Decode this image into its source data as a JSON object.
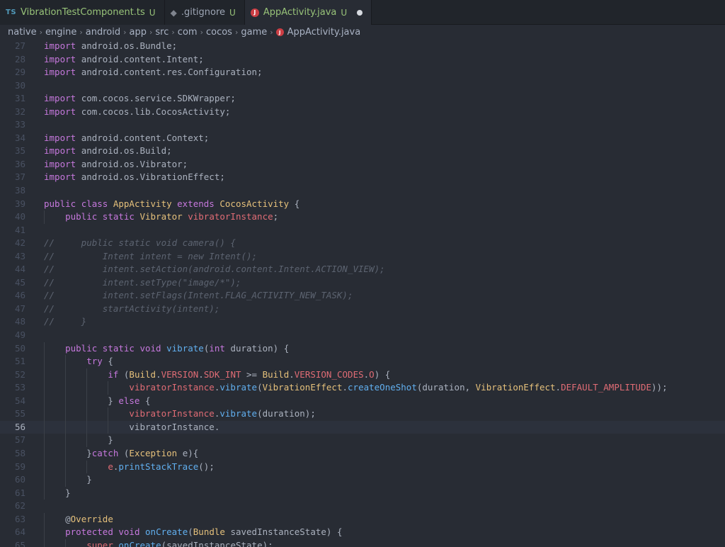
{
  "tabs": [
    {
      "icon": "TS",
      "icon_kind": "ts",
      "label": "VibrationTestComponent.ts",
      "status": "U",
      "active": false
    },
    {
      "icon": "◆",
      "icon_kind": "git",
      "label": ".gitignore",
      "status": "U",
      "active": false
    },
    {
      "icon": "J",
      "icon_kind": "java",
      "label": "AppActivity.java",
      "status": "U",
      "active": true,
      "unsaved": true
    }
  ],
  "breadcrumb": [
    "native",
    "engine",
    "android",
    "app",
    "src",
    "com",
    "cocos",
    "game",
    "AppActivity.java"
  ],
  "current_line": 56,
  "code_lines": [
    {
      "n": "27",
      "t": [
        [
          "keyword",
          "import "
        ],
        [
          "plain",
          "android.os.Bundle;"
        ]
      ]
    },
    {
      "n": "28",
      "t": [
        [
          "keyword",
          "import "
        ],
        [
          "plain",
          "android.content.Intent;"
        ]
      ]
    },
    {
      "n": "29",
      "t": [
        [
          "keyword",
          "import "
        ],
        [
          "plain",
          "android.content.res.Configuration;"
        ]
      ]
    },
    {
      "n": "30",
      "t": []
    },
    {
      "n": "31",
      "t": [
        [
          "keyword",
          "import "
        ],
        [
          "plain",
          "com.cocos.service.SDKWrapper;"
        ]
      ]
    },
    {
      "n": "32",
      "t": [
        [
          "keyword",
          "import "
        ],
        [
          "plain",
          "com.cocos.lib.CocosActivity;"
        ]
      ]
    },
    {
      "n": "33",
      "t": []
    },
    {
      "n": "34",
      "t": [
        [
          "keyword",
          "import "
        ],
        [
          "plain",
          "android.content.Context;"
        ]
      ]
    },
    {
      "n": "35",
      "t": [
        [
          "keyword",
          "import "
        ],
        [
          "plain",
          "android.os.Build;"
        ]
      ]
    },
    {
      "n": "36",
      "t": [
        [
          "keyword",
          "import "
        ],
        [
          "plain",
          "android.os.Vibrator;"
        ]
      ]
    },
    {
      "n": "37",
      "t": [
        [
          "keyword",
          "import "
        ],
        [
          "plain",
          "android.os.VibrationEffect;"
        ]
      ]
    },
    {
      "n": "38",
      "t": []
    },
    {
      "n": "39",
      "t": [
        [
          "keyword",
          "public "
        ],
        [
          "keyword",
          "class "
        ],
        [
          "type",
          "AppActivity "
        ],
        [
          "keyword",
          "extends "
        ],
        [
          "type",
          "CocosActivity "
        ],
        [
          "plain",
          "{"
        ]
      ]
    },
    {
      "n": "40",
      "t": [
        [
          "plain",
          "    "
        ],
        [
          "keyword",
          "public "
        ],
        [
          "keyword",
          "static "
        ],
        [
          "type",
          "Vibrator "
        ],
        [
          "var",
          "vibratorInstance"
        ],
        [
          "plain",
          ";"
        ]
      ]
    },
    {
      "n": "41",
      "t": []
    },
    {
      "n": "42",
      "t": [
        [
          "comment",
          "//     public static void camera() {"
        ]
      ]
    },
    {
      "n": "43",
      "t": [
        [
          "comment",
          "//         Intent intent = new Intent();"
        ]
      ]
    },
    {
      "n": "44",
      "t": [
        [
          "comment",
          "//         intent.setAction(android.content.Intent.ACTION_VIEW);"
        ]
      ]
    },
    {
      "n": "45",
      "t": [
        [
          "comment",
          "//         intent.setType(\"image/*\");"
        ]
      ]
    },
    {
      "n": "46",
      "t": [
        [
          "comment",
          "//         intent.setFlags(Intent.FLAG_ACTIVITY_NEW_TASK);"
        ]
      ]
    },
    {
      "n": "47",
      "t": [
        [
          "comment",
          "//         startActivity(intent);"
        ]
      ]
    },
    {
      "n": "48",
      "t": [
        [
          "comment",
          "//     }"
        ]
      ]
    },
    {
      "n": "49",
      "t": []
    },
    {
      "n": "50",
      "t": [
        [
          "plain",
          "    "
        ],
        [
          "keyword",
          "public "
        ],
        [
          "keyword",
          "static "
        ],
        [
          "keyword",
          "void "
        ],
        [
          "func",
          "vibrate"
        ],
        [
          "plain",
          "("
        ],
        [
          "keyword",
          "int "
        ],
        [
          "plain",
          "duration) {"
        ]
      ]
    },
    {
      "n": "51",
      "t": [
        [
          "plain",
          "        "
        ],
        [
          "keyword",
          "try "
        ],
        [
          "plain",
          "{"
        ]
      ]
    },
    {
      "n": "52",
      "t": [
        [
          "plain",
          "            "
        ],
        [
          "keyword",
          "if "
        ],
        [
          "plain",
          "("
        ],
        [
          "type",
          "Build"
        ],
        [
          "plain",
          "."
        ],
        [
          "var",
          "VERSION"
        ],
        [
          "plain",
          "."
        ],
        [
          "var",
          "SDK_INT "
        ],
        [
          "plain",
          ">= "
        ],
        [
          "type",
          "Build"
        ],
        [
          "plain",
          "."
        ],
        [
          "var",
          "VERSION_CODES"
        ],
        [
          "plain",
          "."
        ],
        [
          "var",
          "O"
        ],
        [
          "plain",
          ") {"
        ]
      ]
    },
    {
      "n": "53",
      "t": [
        [
          "plain",
          "                "
        ],
        [
          "var",
          "vibratorInstance"
        ],
        [
          "plain",
          "."
        ],
        [
          "func",
          "vibrate"
        ],
        [
          "plain",
          "("
        ],
        [
          "type",
          "VibrationEffect"
        ],
        [
          "plain",
          "."
        ],
        [
          "func",
          "createOneShot"
        ],
        [
          "plain",
          "(duration, "
        ],
        [
          "type",
          "VibrationEffect"
        ],
        [
          "plain",
          "."
        ],
        [
          "var",
          "DEFAULT_AMPLITUDE"
        ],
        [
          "plain",
          "));"
        ]
      ]
    },
    {
      "n": "54",
      "t": [
        [
          "plain",
          "            } "
        ],
        [
          "keyword",
          "else "
        ],
        [
          "plain",
          "{"
        ]
      ]
    },
    {
      "n": "55",
      "t": [
        [
          "plain",
          "                "
        ],
        [
          "var",
          "vibratorInstance"
        ],
        [
          "plain",
          "."
        ],
        [
          "func",
          "vibrate"
        ],
        [
          "plain",
          "(duration);"
        ]
      ]
    },
    {
      "n": "56",
      "t": [
        [
          "plain",
          "                vibratorInstance."
        ]
      ]
    },
    {
      "n": "57",
      "t": [
        [
          "plain",
          "            }"
        ]
      ]
    },
    {
      "n": "58",
      "t": [
        [
          "plain",
          "        }"
        ],
        [
          "keyword",
          "catch "
        ],
        [
          "plain",
          "("
        ],
        [
          "type",
          "Exception "
        ],
        [
          "plain",
          "e){"
        ]
      ]
    },
    {
      "n": "59",
      "t": [
        [
          "plain",
          "            "
        ],
        [
          "var",
          "e"
        ],
        [
          "plain",
          "."
        ],
        [
          "func",
          "printStackTrace"
        ],
        [
          "plain",
          "();"
        ]
      ]
    },
    {
      "n": "60",
      "t": [
        [
          "plain",
          "        }"
        ]
      ]
    },
    {
      "n": "61",
      "t": [
        [
          "plain",
          "    }"
        ]
      ]
    },
    {
      "n": "62",
      "t": []
    },
    {
      "n": "63",
      "t": [
        [
          "plain",
          "    @"
        ],
        [
          "type",
          "Override"
        ]
      ]
    },
    {
      "n": "64",
      "t": [
        [
          "plain",
          "    "
        ],
        [
          "keyword",
          "protected "
        ],
        [
          "keyword",
          "void "
        ],
        [
          "func",
          "onCreate"
        ],
        [
          "plain",
          "("
        ],
        [
          "type",
          "Bundle "
        ],
        [
          "plain",
          "savedInstanceState) {"
        ]
      ]
    },
    {
      "n": "65",
      "t": [
        [
          "plain",
          "        "
        ],
        [
          "var",
          "super"
        ],
        [
          "plain",
          "."
        ],
        [
          "func",
          "onCreate"
        ],
        [
          "plain",
          "(savedInstanceState);"
        ]
      ]
    }
  ],
  "colors": {
    "background": "#282c34",
    "keyword": "#c678dd",
    "type": "#e5c07b",
    "function": "#61afef",
    "variable": "#e06c75",
    "comment": "#5c6370",
    "untracked": "#98c379"
  }
}
